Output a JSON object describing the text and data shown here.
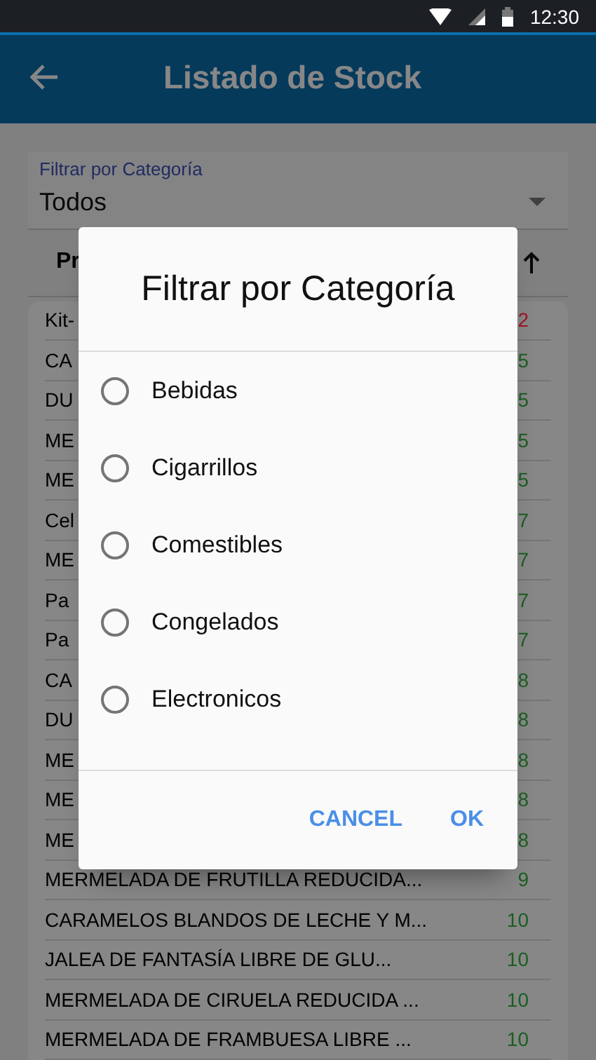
{
  "status_bar": {
    "time": "12:30"
  },
  "app_bar": {
    "title": "Listado de Stock"
  },
  "filter": {
    "label": "Filtrar por Categoría",
    "value": "Todos"
  },
  "table": {
    "header": "Pr",
    "rows": [
      {
        "name": "Kit-",
        "count": "2",
        "color": "#9e1420"
      },
      {
        "name": "CA",
        "count": "5",
        "color": "#1b5e20"
      },
      {
        "name": "DU",
        "count": "5",
        "color": "#1b5e20"
      },
      {
        "name": "ME",
        "count": "5",
        "color": "#1b5e20"
      },
      {
        "name": "ME",
        "count": "5",
        "color": "#1b5e20"
      },
      {
        "name": "Cel",
        "count": "7",
        "color": "#1b5e20"
      },
      {
        "name": "ME",
        "count": "7",
        "color": "#1b5e20"
      },
      {
        "name": "Pa",
        "count": "7",
        "color": "#1b5e20"
      },
      {
        "name": "Pa",
        "count": "7",
        "color": "#1b5e20"
      },
      {
        "name": "CA",
        "count": "8",
        "color": "#1b5e20"
      },
      {
        "name": "DU",
        "count": "8",
        "color": "#1b5e20"
      },
      {
        "name": "ME",
        "count": "8",
        "color": "#1b5e20"
      },
      {
        "name": "ME",
        "count": "8",
        "color": "#1b5e20"
      },
      {
        "name": "ME",
        "count": "8",
        "color": "#1b5e20"
      },
      {
        "name": "MERMELADA DE FRUTILLA REDUCIDA...",
        "count": "9",
        "color": "#1b5e20"
      },
      {
        "name": "CARAMELOS BLANDOS DE LECHE Y M...",
        "count": "10",
        "color": "#1b5e20"
      },
      {
        "name": "JALEA DE FANTASÍA LIBRE DE GLU...",
        "count": "10",
        "color": "#1b5e20"
      },
      {
        "name": "MERMELADA DE CIRUELA REDUCIDA ...",
        "count": "10",
        "color": "#1b5e20"
      },
      {
        "name": "MERMELADA DE FRAMBUESA LIBRE ...",
        "count": "10",
        "color": "#1b5e20"
      }
    ]
  },
  "dialog": {
    "title": "Filtrar por Categoría",
    "options": [
      {
        "label": "Bebidas",
        "selected": false
      },
      {
        "label": "Cigarrillos",
        "selected": false
      },
      {
        "label": "Comestibles",
        "selected": false
      },
      {
        "label": "Congelados",
        "selected": false
      },
      {
        "label": "Electronicos",
        "selected": false
      }
    ],
    "buttons": [
      "CANCEL",
      "OK"
    ]
  }
}
